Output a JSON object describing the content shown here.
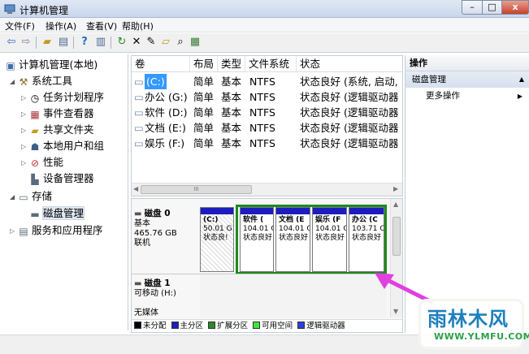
{
  "window": {
    "title": "计算机管理",
    "controls": {
      "minimize": "–",
      "maximize": "□",
      "close": "x"
    }
  },
  "menubar": [
    "文件(F)",
    "操作(A)",
    "查看(V)",
    "帮助(H)"
  ],
  "toolbar_icons": [
    "back-icon",
    "forward-icon",
    "up-folder-icon",
    "console-tree-icon",
    "help-icon",
    "properties-icon",
    "refresh-icon",
    "delete-icon",
    "properties-2-icon",
    "open-folder-icon",
    "search-icon",
    "export-icon"
  ],
  "tree": {
    "root": "计算机管理(本地)",
    "items": [
      {
        "label": "系统工具",
        "level": 1,
        "expanded": true,
        "icon": "tools-icon"
      },
      {
        "label": "任务计划程序",
        "level": 2,
        "expanded": false,
        "icon": "clock-icon"
      },
      {
        "label": "事件查看器",
        "level": 2,
        "expanded": false,
        "icon": "event-viewer-icon"
      },
      {
        "label": "共享文件夹",
        "level": 2,
        "expanded": false,
        "icon": "shared-folder-icon"
      },
      {
        "label": "本地用户和组",
        "level": 2,
        "expanded": false,
        "icon": "users-icon"
      },
      {
        "label": "性能",
        "level": 2,
        "expanded": false,
        "icon": "performance-icon"
      },
      {
        "label": "设备管理器",
        "level": 2,
        "expanded": null,
        "icon": "device-manager-icon"
      },
      {
        "label": "存储",
        "level": 1,
        "expanded": true,
        "icon": "storage-icon"
      },
      {
        "label": "磁盘管理",
        "level": 2,
        "expanded": null,
        "icon": "disk-management-icon",
        "selected": true
      },
      {
        "label": "服务和应用程序",
        "level": 1,
        "expanded": false,
        "icon": "services-icon"
      }
    ]
  },
  "volume_list": {
    "columns": [
      "卷",
      "布局",
      "类型",
      "文件系统",
      "状态"
    ],
    "rows": [
      {
        "volume": "(C:)",
        "layout": "简单",
        "type": "基本",
        "fs": "NTFS",
        "status": "状态良好 (系统, 启动,"
      },
      {
        "volume": "办公 (G:)",
        "layout": "简单",
        "type": "基本",
        "fs": "NTFS",
        "status": "状态良好 (逻辑驱动器"
      },
      {
        "volume": "软件 (D:)",
        "layout": "简单",
        "type": "基本",
        "fs": "NTFS",
        "status": "状态良好 (逻辑驱动器"
      },
      {
        "volume": "文档 (E:)",
        "layout": "简单",
        "type": "基本",
        "fs": "NTFS",
        "status": "状态良好 (逻辑驱动器"
      },
      {
        "volume": "娱乐 (F:)",
        "layout": "简单",
        "type": "基本",
        "fs": "NTFS",
        "status": "状态良好 (逻辑驱动器"
      }
    ],
    "hscroll_thumb": "III"
  },
  "disks": [
    {
      "name": "磁盘 0",
      "kind": "基本",
      "size": "465.76 GB",
      "state": "联机",
      "partitions": [
        {
          "label": "(C:)",
          "size": "50.01 G",
          "status": "状态良!",
          "bar_color": "#1d1dbf"
        },
        {
          "label": "软件 (",
          "size": "104.01 G",
          "status": "状态良好",
          "bar_color": "#1d1dbf"
        },
        {
          "label": "文档 (E",
          "size": "104.01 G",
          "status": "状态良好",
          "bar_color": "#1d1dbf"
        },
        {
          "label": "娱乐 (F",
          "size": "104.01 G",
          "status": "状态良好",
          "bar_color": "#1d1dbf"
        },
        {
          "label": "办公 (C",
          "size": "103.71 C",
          "status": "状态良好",
          "bar_color": "#1d1dbf"
        }
      ]
    },
    {
      "name": "磁盘 1",
      "kind": "可移动 (H:)",
      "size": "",
      "state": "无媒体",
      "partitions": []
    }
  ],
  "legend": [
    {
      "label": "未分配",
      "color": "#000000"
    },
    {
      "label": "主分区",
      "color": "#1d1dbf"
    },
    {
      "label": "扩展分区",
      "color": "#2a8a2a"
    },
    {
      "label": "可用空间",
      "color": "#3ce83c"
    },
    {
      "label": "逻辑驱动器",
      "color": "#2e3fd8"
    }
  ],
  "actions": {
    "header": "操作",
    "section": "磁盘管理",
    "item": "更多操作"
  },
  "watermark": {
    "logo": "雨林木风",
    "url": "WWW.YLMFU.COM"
  },
  "colors": {
    "extended_outline": "#1e8a1e",
    "annotation_arrow": "#e040e0",
    "primary_bar": "#1d1dbf"
  }
}
